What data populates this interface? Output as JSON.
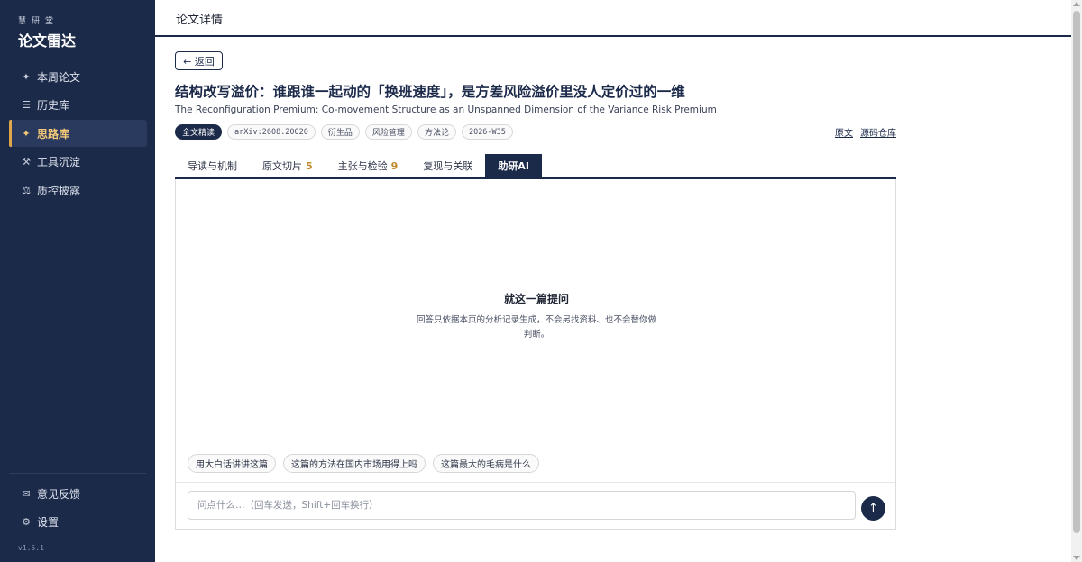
{
  "brand": {
    "sub": "慧研堂",
    "title": "论文雷达"
  },
  "sidebar": {
    "items": [
      {
        "icon": "✦",
        "label": "本周论文"
      },
      {
        "icon": "☰",
        "label": "历史库"
      },
      {
        "icon": "✦",
        "label": "思路库",
        "active": true
      },
      {
        "icon": "⚒",
        "label": "工具沉淀"
      },
      {
        "icon": "⚖",
        "label": "质控披露"
      }
    ],
    "bottom_items": [
      {
        "icon": "✉",
        "label": "意见反馈"
      },
      {
        "icon": "⚙",
        "label": "设置"
      }
    ],
    "version": "v1.5.1"
  },
  "header": {
    "title": "论文详情"
  },
  "back_label": "← 返回",
  "paper": {
    "title": "结构改写溢价：谁跟谁一起动的「换班速度」，是方差风险溢价里没人定价过的一维",
    "subtitle": "The Reconfiguration Premium: Co-movement Structure as an Unspanned Dimension of the Variance Risk Premium",
    "tags": [
      "全文精读",
      "arXiv:2608.20020",
      "衍生品",
      "风险管理",
      "方法论",
      "2026-W35"
    ],
    "links": {
      "original": "原文",
      "repo": "源码仓库"
    }
  },
  "tabs": [
    {
      "label": "导读与机制",
      "count": ""
    },
    {
      "label": "原文切片",
      "count": "5"
    },
    {
      "label": "主张与检验",
      "count": "9"
    },
    {
      "label": "复现与关联",
      "count": ""
    },
    {
      "label": "助研AI",
      "count": "",
      "active": true
    }
  ],
  "assistant": {
    "empty_title": "就这一篇提问",
    "empty_desc": "回答只依据本页的分析记录生成，不会另找资料、也不会替你做判断。",
    "suggestions": [
      "用大白话讲讲这篇",
      "这篇的方法在国内市场用得上吗",
      "这篇最大的毛病是什么"
    ],
    "input_placeholder": "问点什么…（回车发送，Shift+回车换行）",
    "send_icon": "↑"
  },
  "colors": {
    "navy": "#1c2a4a",
    "accent": "#f3c778",
    "count": "#c08a2a"
  }
}
